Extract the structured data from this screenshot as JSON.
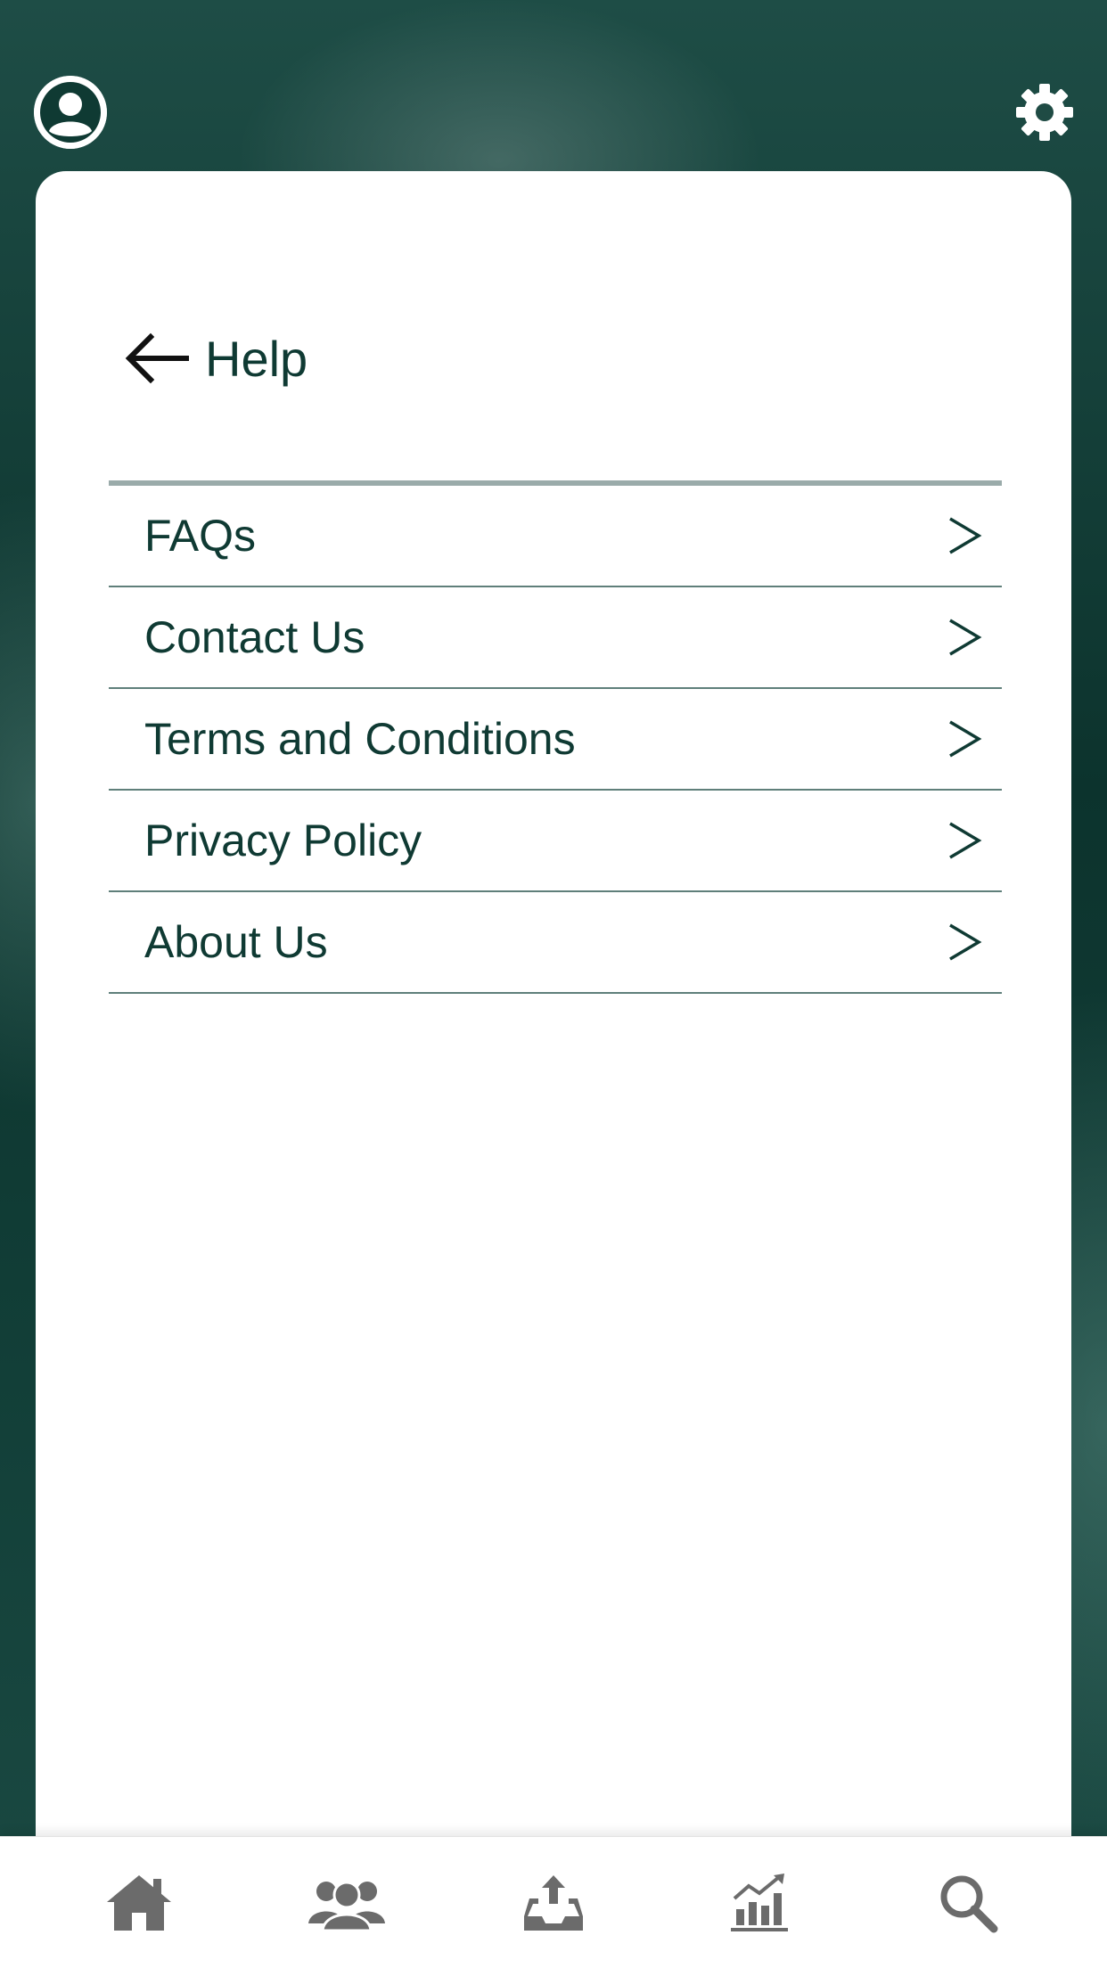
{
  "colors": {
    "accent": "#0f3a33",
    "divider": "#5f7f7a",
    "topDivider": "#9aabaa",
    "icon": "#6b6b6b"
  },
  "header": {
    "title": "Help",
    "back_icon": "arrow-left-icon"
  },
  "topbar": {
    "profile_icon": "user-circle-icon",
    "settings_icon": "gear-icon"
  },
  "menu": {
    "items": [
      {
        "label": "FAQs",
        "icon": "chevron-right-icon"
      },
      {
        "label": "Contact Us",
        "icon": "chevron-right-icon"
      },
      {
        "label": "Terms and Conditions",
        "icon": "chevron-right-icon"
      },
      {
        "label": "Privacy Policy",
        "icon": "chevron-right-icon"
      },
      {
        "label": "About Us",
        "icon": "chevron-right-icon"
      }
    ]
  },
  "tabbar": {
    "tabs": [
      {
        "icon": "home-icon"
      },
      {
        "icon": "users-icon"
      },
      {
        "icon": "upload-tray-icon"
      },
      {
        "icon": "bar-chart-icon"
      },
      {
        "icon": "search-icon"
      }
    ]
  }
}
